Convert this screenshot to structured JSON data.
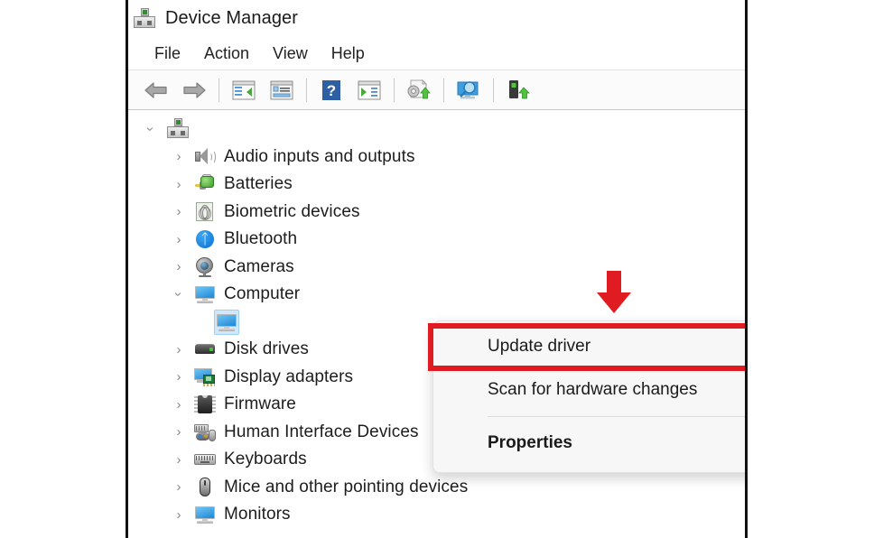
{
  "window": {
    "title": "Device Manager",
    "title_icon": "device-manager-icon"
  },
  "menubar": {
    "items": [
      {
        "label": "File"
      },
      {
        "label": "Action"
      },
      {
        "label": "View"
      },
      {
        "label": "Help"
      }
    ]
  },
  "toolbar": {
    "buttons": [
      {
        "icon": "back-arrow-icon",
        "label": "Back"
      },
      {
        "icon": "forward-arrow-icon",
        "label": "Forward"
      },
      {
        "icon": "show-hide-console-tree-icon",
        "label": "Show/Hide Console Tree"
      },
      {
        "icon": "properties-icon",
        "label": "Properties"
      },
      {
        "icon": "help-icon",
        "label": "Help"
      },
      {
        "icon": "show-hide-action-pane-icon",
        "label": "Show/Hide Action Pane"
      },
      {
        "icon": "update-driver-icon",
        "label": "Update Driver"
      },
      {
        "icon": "scan-for-hardware-changes-icon",
        "label": "Scan for hardware changes"
      },
      {
        "icon": "disable-device-icon",
        "label": "Disable device"
      }
    ]
  },
  "tree": {
    "root": {
      "label": "",
      "icon": "computer-root-icon",
      "expanded": true
    },
    "items": [
      {
        "label": "Audio inputs and outputs",
        "icon": "speaker-icon",
        "expanded": false,
        "level": 1
      },
      {
        "label": "Batteries",
        "icon": "battery-icon",
        "expanded": false,
        "level": 1
      },
      {
        "label": "Biometric devices",
        "icon": "fingerprint-icon",
        "expanded": false,
        "level": 1
      },
      {
        "label": "Bluetooth",
        "icon": "bluetooth-icon",
        "expanded": false,
        "level": 1
      },
      {
        "label": "Cameras",
        "icon": "camera-icon",
        "expanded": false,
        "level": 1
      },
      {
        "label": "Computer",
        "icon": "monitor-icon",
        "expanded": true,
        "level": 1
      },
      {
        "label": "",
        "icon": "monitor-icon",
        "expanded": null,
        "level": 2,
        "selected": true
      },
      {
        "label": "Disk drives",
        "icon": "disk-drive-icon",
        "expanded": false,
        "level": 1
      },
      {
        "label": "Display adapters",
        "icon": "display-adapter-icon",
        "expanded": false,
        "level": 1
      },
      {
        "label": "Firmware",
        "icon": "firmware-chip-icon",
        "expanded": false,
        "level": 1
      },
      {
        "label": "Human Interface Devices",
        "icon": "hid-icon",
        "expanded": false,
        "level": 1
      },
      {
        "label": "Keyboards",
        "icon": "keyboard-icon",
        "expanded": false,
        "level": 1
      },
      {
        "label": "Mice and other pointing devices",
        "icon": "mouse-icon",
        "expanded": false,
        "level": 1
      },
      {
        "label": "Monitors",
        "icon": "monitor-icon",
        "expanded": false,
        "level": 1
      }
    ]
  },
  "context_menu": {
    "items": [
      {
        "label": "Update driver",
        "highlighted": true,
        "bold": false
      },
      {
        "label": "Scan for hardware changes",
        "highlighted": false,
        "bold": false
      },
      {
        "label": "Properties",
        "highlighted": false,
        "bold": true
      }
    ]
  },
  "annotations": {
    "arrow": {
      "name": "red-down-arrow",
      "color": "#e01b22",
      "points_to": "Update driver"
    },
    "highlight_box": {
      "name": "red-highlight-box",
      "color": "#e01b22",
      "around": "Update driver"
    }
  },
  "colors": {
    "annotation_red": "#e01b22",
    "selection_blue": "#cfe8fc",
    "window_border": "#111111",
    "menu_background": "#f7f7f7"
  }
}
